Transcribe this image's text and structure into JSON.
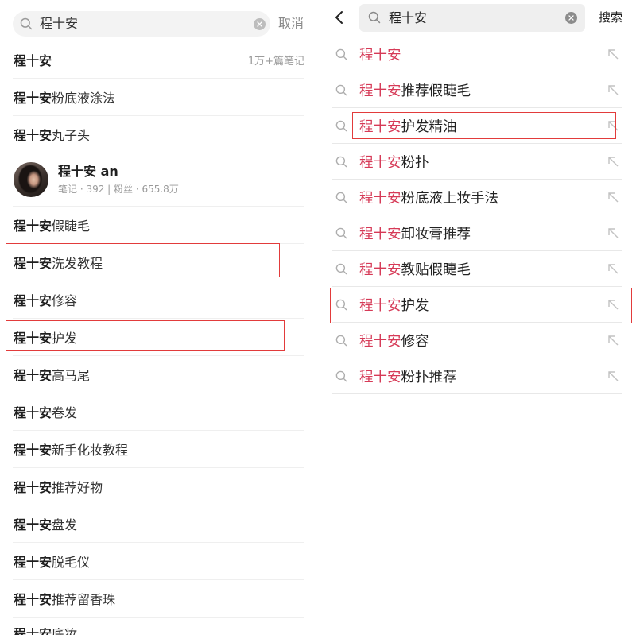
{
  "colors": {
    "keyword_highlight": "#d63a57",
    "annotation_outline": "#e23b3b"
  },
  "left_screen": {
    "search": {
      "icon": "search-icon",
      "query": "程十安",
      "clear_icon": "clear-icon",
      "cancel_label": "取消"
    },
    "suggestions": [
      {
        "keyword": "程十安",
        "meta": "1万+篇笔记"
      },
      {
        "keyword": "程十安",
        "rest": "粉底液涂法"
      },
      {
        "keyword": "程十安",
        "rest": "丸子头"
      },
      {
        "keyword": "程十安",
        "rest": "假睫毛"
      },
      {
        "keyword": "程十安",
        "rest": "洗发教程"
      },
      {
        "keyword": "程十安",
        "rest": "修容"
      },
      {
        "keyword": "程十安",
        "rest": "护发"
      },
      {
        "keyword": "程十安",
        "rest": "高马尾"
      },
      {
        "keyword": "程十安",
        "rest": "卷发"
      },
      {
        "keyword": "程十安",
        "rest": "新手化妆教程"
      },
      {
        "keyword": "程十安",
        "rest": "推荐好物"
      },
      {
        "keyword": "程十安",
        "rest": "盘发"
      },
      {
        "keyword": "程十安",
        "rest": "脱毛仪"
      },
      {
        "keyword": "程十安",
        "rest": "推荐留香珠"
      },
      {
        "keyword": "程十安",
        "rest": "底妆"
      }
    ],
    "user_card": {
      "name": "程十安 an",
      "stats": "笔记 · 392 | 粉丝 · 655.8万"
    }
  },
  "right_screen": {
    "back_icon": "chevron-left-icon",
    "search": {
      "icon": "search-icon",
      "query": "程十安",
      "clear_icon": "clear-icon",
      "submit_label": "搜索"
    },
    "row_icon": "search-icon",
    "row_action_icon": "arrow-up-left-icon",
    "suggestions": [
      {
        "keyword": "程十安"
      },
      {
        "keyword": "程十安",
        "rest": "推荐假睫毛"
      },
      {
        "keyword": "程十安",
        "rest": "护发精油"
      },
      {
        "keyword": "程十安",
        "rest": "粉扑"
      },
      {
        "keyword": "程十安",
        "rest": "粉底液上妆手法"
      },
      {
        "keyword": "程十安",
        "rest": "卸妆膏推荐"
      },
      {
        "keyword": "程十安",
        "rest": "教贴假睫毛"
      },
      {
        "keyword": "程十安",
        "rest": "护发"
      },
      {
        "keyword": "程十安",
        "rest": "修容"
      },
      {
        "keyword": "程十安",
        "rest": "粉扑推荐"
      }
    ]
  }
}
